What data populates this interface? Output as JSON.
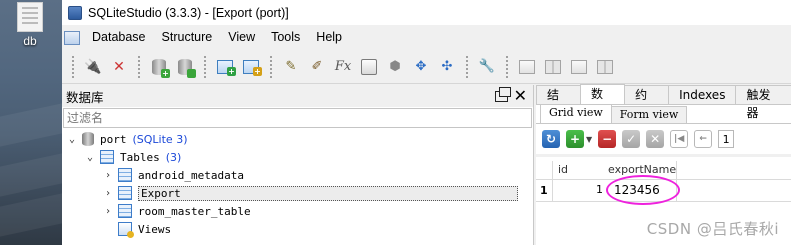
{
  "desktop": {
    "icon_label": "db"
  },
  "window": {
    "title": "SQLiteStudio (3.3.3) - [Export (port)]"
  },
  "menu": [
    "Database",
    "Structure",
    "View",
    "Tools",
    "Help"
  ],
  "left_panel": {
    "title": "数据库",
    "filter_placeholder": "过滤名",
    "tree": {
      "db_name": "port",
      "db_type": "(SQLite 3)",
      "tables_label": "Tables",
      "tables_count": "(3)",
      "tables": [
        "android_metadata",
        "Export",
        "room_master_table"
      ],
      "selected_table": "Export",
      "views_label": "Views"
    }
  },
  "right_panel": {
    "tabs": [
      "结构",
      "数据",
      "约束",
      "Indexes",
      "触发器"
    ],
    "active_tab": "数据",
    "subtabs": [
      "Grid view",
      "Form view"
    ],
    "active_subtab": "Grid view",
    "page_number": "1",
    "grid": {
      "columns": [
        "id",
        "exportName"
      ],
      "rows": [
        {
          "row_number": "1",
          "id": "1",
          "exportName": "123456"
        }
      ]
    }
  },
  "watermark": "CSDN @吕氏春秋i",
  "colors": {
    "annotation_ellipse": "#ee22dd",
    "link_blue": "#1b48d8"
  }
}
